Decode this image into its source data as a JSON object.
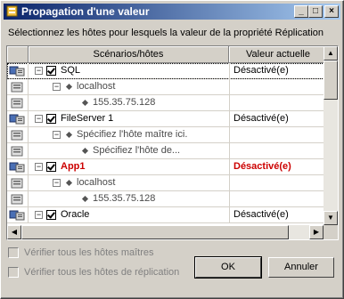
{
  "window": {
    "title": "Propagation d'une valeur"
  },
  "instruction": "Sélectionnez les hôtes pour lesquels la valeur de la propriété Réplication",
  "grid": {
    "columns": [
      "Scénarios/hôtes",
      "Valeur actuelle"
    ],
    "rows": [
      {
        "name": "SQL",
        "value": "Désactivé(e)",
        "level": 0
      },
      {
        "name": "localhost",
        "value": "",
        "level": 1
      },
      {
        "name": "155.35.75.128",
        "value": "",
        "level": 2
      },
      {
        "name": "FileServer 1",
        "value": "Désactivé(e)",
        "level": 0
      },
      {
        "name": "Spécifiez l'hôte maître ici.",
        "value": "",
        "level": 1
      },
      {
        "name": "Spécifiez l'hôte de...",
        "value": "",
        "level": 2
      },
      {
        "name": "App1",
        "value": "Désactivé(e)",
        "level": 0
      },
      {
        "name": "localhost",
        "value": "",
        "level": 1
      },
      {
        "name": "155.35.75.128",
        "value": "",
        "level": 2
      },
      {
        "name": "Oracle",
        "value": "Désactivé(e)",
        "level": 0
      }
    ]
  },
  "options": {
    "check_all_masters": "Vérifier tous les hôtes maîtres",
    "check_all_replicas": "Vérifier tous les hôtes de réplication"
  },
  "buttons": {
    "ok": "OK",
    "cancel": "Annuler"
  },
  "colors": {
    "highlight_red": "#cc0000",
    "title_gradient_start": "#0a246a"
  }
}
